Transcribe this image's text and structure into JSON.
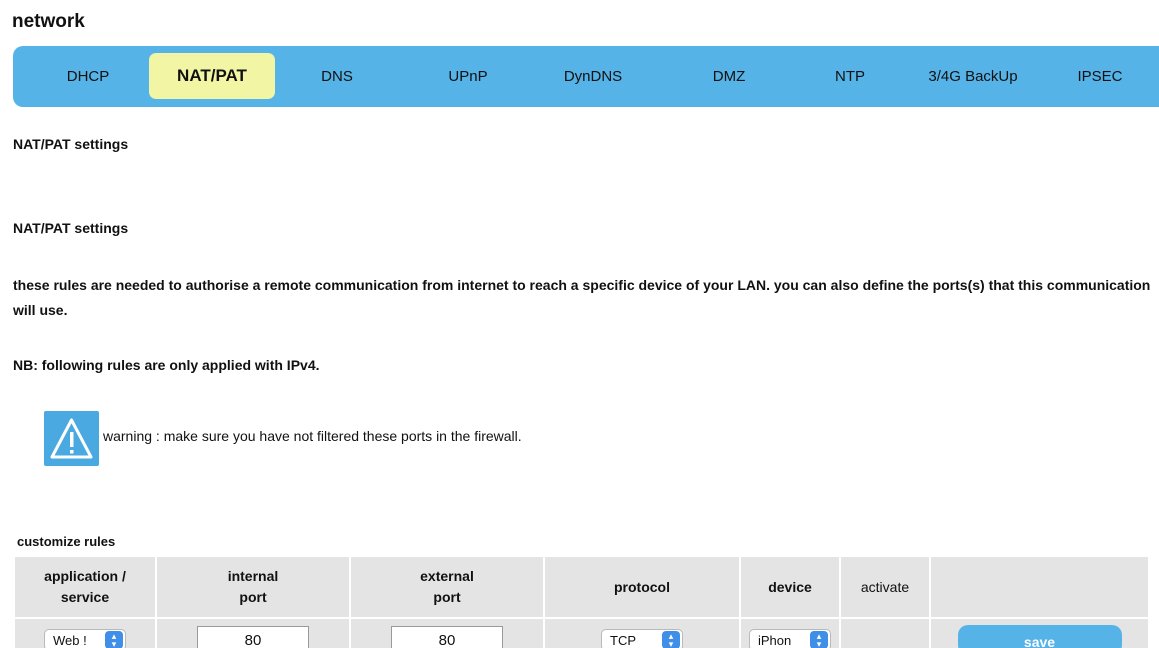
{
  "page": {
    "title": "network"
  },
  "tabs": [
    {
      "label": "DHCP",
      "active": false
    },
    {
      "label": "NAT/PAT",
      "active": true
    },
    {
      "label": "DNS",
      "active": false
    },
    {
      "label": "UPnP",
      "active": false
    },
    {
      "label": "DynDNS",
      "active": false
    },
    {
      "label": "DMZ",
      "active": false
    },
    {
      "label": "NTP",
      "active": false
    },
    {
      "label": "3/4G BackUp",
      "active": false
    },
    {
      "label": "IPSEC",
      "active": false
    }
  ],
  "section": {
    "heading1": "NAT/PAT settings",
    "heading2": "NAT/PAT settings",
    "description": "these rules are needed to authorise a remote communication from internet to reach a specific device of your LAN. you can also define the ports(s) that this communication will use.",
    "nb": "NB: following rules are only applied with IPv4.",
    "warning": "warning : make sure you have not filtered these ports in the firewall."
  },
  "rules": {
    "title": "customize rules",
    "headers": {
      "application": [
        "application /",
        "service"
      ],
      "internal_port": [
        "internal",
        "port"
      ],
      "external_port": [
        "external",
        "port"
      ],
      "protocol": "protocol",
      "device": "device",
      "activate": "activate"
    },
    "row": {
      "application": "Web !",
      "internal_port": "80",
      "external_port": "80",
      "protocol": "TCP",
      "device": "iPhon",
      "save_label": "save"
    }
  },
  "colors": {
    "tabbar": "#55b3e8",
    "active_tab": "#f1f5a4",
    "table_bg": "#e4e4e4",
    "accent": "#3f8ee8"
  },
  "icons": {
    "warning": "warning-triangle-icon",
    "select_arrow": "chevron-up-down-icon"
  }
}
